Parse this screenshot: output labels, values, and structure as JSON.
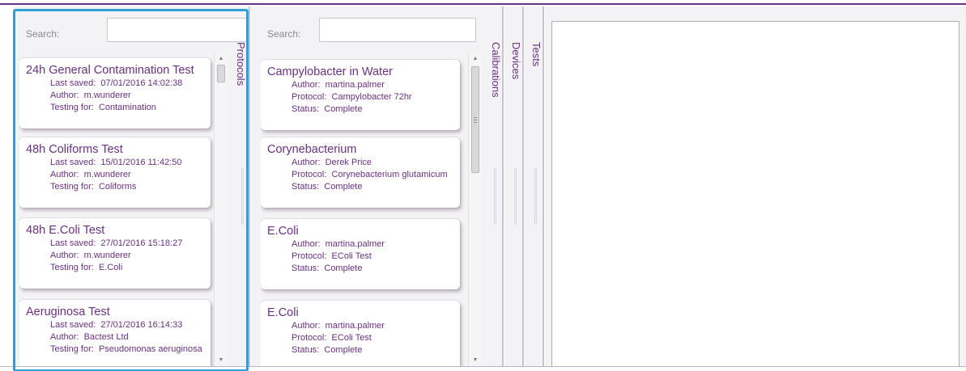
{
  "protocols_panel": {
    "search_label": "Search:",
    "search_value": "",
    "tab_label": "Protocols",
    "items": [
      {
        "title": "24h General Contamination Test",
        "line1_key": "Last saved:",
        "line1_val": "07/01/2016 14:02:38",
        "line2_key": "Author:",
        "line2_val": "m.wunderer",
        "line3_key": "Testing for:",
        "line3_val": "Contamination"
      },
      {
        "title": "48h Coliforms Test",
        "line1_key": "Last saved:",
        "line1_val": "15/01/2016 11:42:50",
        "line2_key": "Author:",
        "line2_val": "m.wunderer",
        "line3_key": "Testing for:",
        "line3_val": "Coliforms"
      },
      {
        "title": "48h E.Coli Test",
        "line1_key": "Last saved:",
        "line1_val": "27/01/2016 15:18:27",
        "line2_key": "Author:",
        "line2_val": "m.wunderer",
        "line3_key": "Testing for:",
        "line3_val": "E.Coli"
      },
      {
        "title": "Aeruginosa Test",
        "line1_key": "Last saved:",
        "line1_val": "27/01/2016 16:14:33",
        "line2_key": "Author:",
        "line2_val": "Bactest Ltd",
        "line3_key": "Testing for:",
        "line3_val": "Pseudomonas aeruginosa"
      }
    ]
  },
  "calibrations_panel": {
    "search_label": "Search:",
    "search_value": "",
    "tab_label": "Calibrations",
    "items": [
      {
        "title": "Campylobacter in Water",
        "line1_key": "Author:",
        "line1_val": "martina.palmer",
        "line2_key": "Protocol:",
        "line2_val": "Campylobacter 72hr",
        "line3_key": "Status:",
        "line3_val": "Complete"
      },
      {
        "title": "Corynebacterium",
        "line1_key": "Author:",
        "line1_val": "Derek Price",
        "line2_key": "Protocol:",
        "line2_val": "Corynebacterium glutamicum",
        "line3_key": "Status:",
        "line3_val": "Complete"
      },
      {
        "title": "E.Coli",
        "line1_key": "Author:",
        "line1_val": "martina.palmer",
        "line2_key": "Protocol:",
        "line2_val": "EColi Test",
        "line3_key": "Status:",
        "line3_val": "Complete"
      },
      {
        "title": "E.Coli",
        "line1_key": "Author:",
        "line1_val": "martina.palmer",
        "line2_key": "Protocol:",
        "line2_val": "EColi Test",
        "line3_key": "Status:",
        "line3_val": "Complete"
      }
    ]
  },
  "devices_tab": {
    "label": "Devices"
  },
  "tests_tab": {
    "label": "Tests"
  },
  "colors": {
    "accent": "#6b2f86",
    "highlight": "#2fa0d8",
    "panel_bg": "#f3f2f4"
  },
  "icons": {
    "scroll_up": "triangle-up",
    "scroll_down": "triangle-down"
  }
}
